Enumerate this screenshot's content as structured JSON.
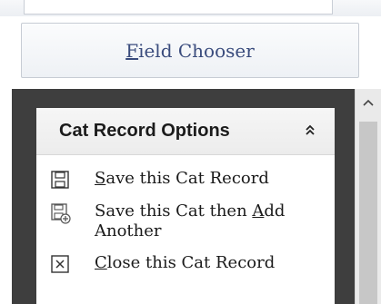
{
  "field_chooser": {
    "label": "Field Chooser",
    "accel": "F",
    "rest": "ield Chooser"
  },
  "options_panel": {
    "title": "Cat Record Options",
    "collapse_glyph": "˄"
  },
  "options": [
    {
      "icon": "save-icon",
      "accel": "S",
      "label_rest": "ave this Cat Record"
    },
    {
      "icon": "save-add-icon",
      "line1_pre": "Save this Cat then ",
      "accel": "A",
      "line1_post": "dd",
      "line2": "Another"
    },
    {
      "icon": "close-box-icon",
      "accel": "C",
      "label_rest": "lose this Cat Record"
    }
  ],
  "scrollbar": {
    "up_glyph": "^"
  },
  "colors": {
    "accent_text": "#3a4c7d",
    "panel_bg": "#3e3e3e"
  }
}
